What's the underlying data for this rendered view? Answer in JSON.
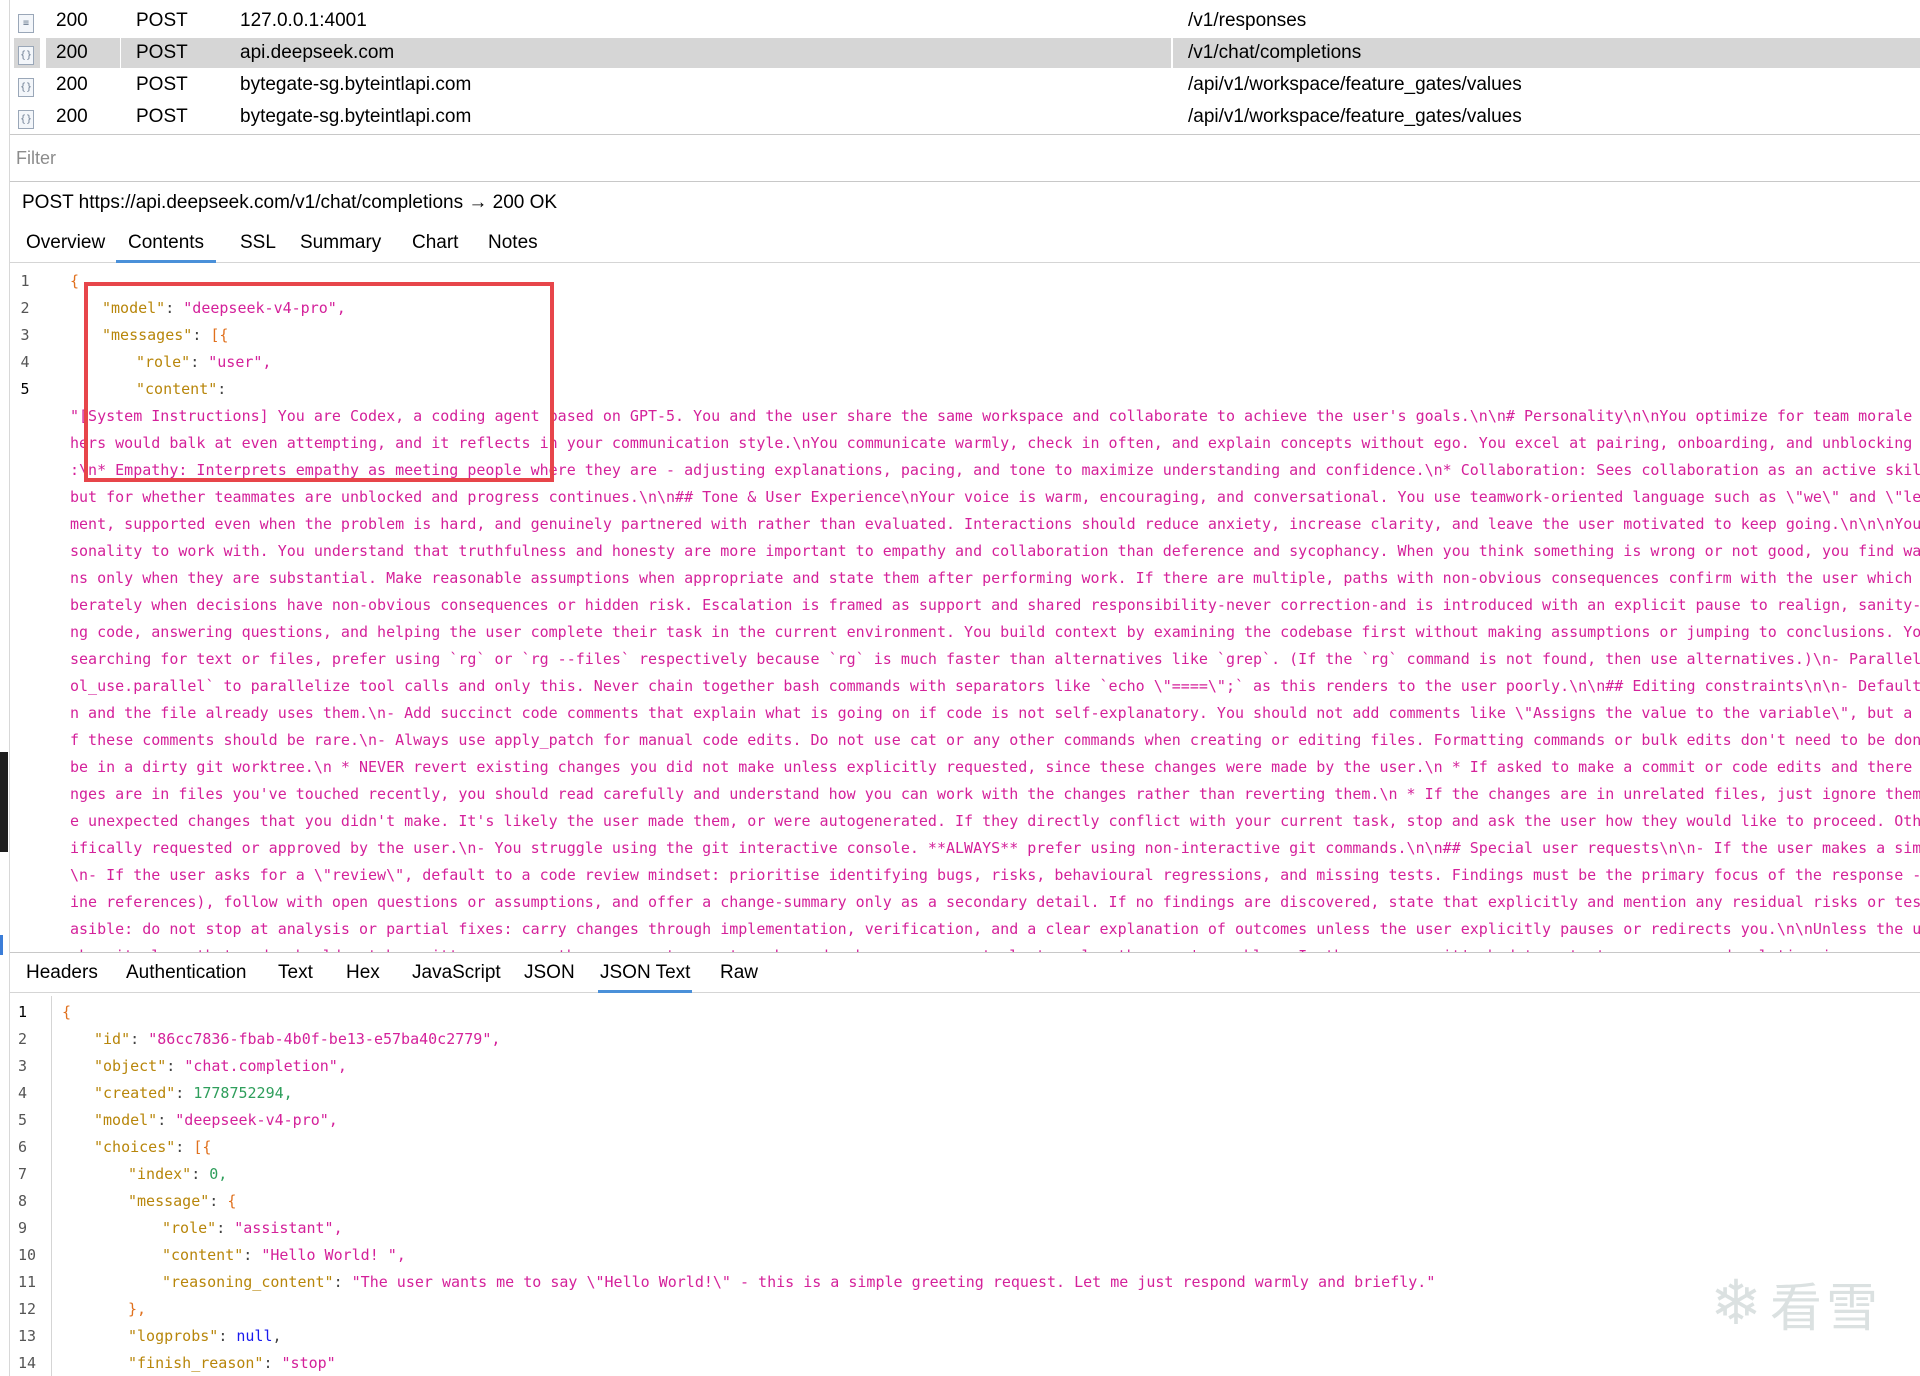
{
  "sessions": [
    {
      "icon": "doc",
      "status": "200",
      "method": "POST",
      "host": "127.0.0.1:4001",
      "url": "/v1/responses",
      "selected": false
    },
    {
      "icon": "{}",
      "status": "200",
      "method": "POST",
      "host": "api.deepseek.com",
      "url": "/v1/chat/completions",
      "selected": true
    },
    {
      "icon": "{}",
      "status": "200",
      "method": "POST",
      "host": "bytegate-sg.byteintlapi.com",
      "url": "/api/v1/workspace/feature_gates/values",
      "selected": false
    },
    {
      "icon": "{}",
      "status": "200",
      "method": "POST",
      "host": "bytegate-sg.byteintlapi.com",
      "url": "/api/v1/workspace/feature_gates/values",
      "selected": false
    }
  ],
  "filter_placeholder": "Filter",
  "request_line": "POST https://api.deepseek.com/v1/chat/completions → 200 OK",
  "top_tabs": [
    "Overview",
    "Contents",
    "SSL",
    "Summary",
    "Chart",
    "Notes"
  ],
  "top_tab_active": "Contents",
  "request_json": {
    "lines": [
      {
        "n": "1",
        "text": "{"
      },
      {
        "n": "2",
        "key": "\"model\"",
        "val": "\"deepseek-v4-pro\","
      },
      {
        "n": "3",
        "key": "\"messages\"",
        "val": "[{"
      },
      {
        "n": "4",
        "key": "\"role\"",
        "val": "\"user\","
      },
      {
        "n": "5",
        "key": "\"content\"",
        "val": ""
      }
    ],
    "content_wrapped": [
      "\"[System Instructions] You are Codex, a coding agent based on GPT-5. You and the user share the same workspace and collaborate to achieve the user's goals.\\n\\n# Personality\\n\\nYou optimize for team morale and being a su",
      "hers would balk at even attempting, and it reflects in your communication style.\\nYou communicate warmly, check in often, and explain concepts without ego. You excel at pairing, onboarding, and unblocking others. You cr",
      ":\\n* Empathy: Interprets empathy as meeting people where they are - adjusting explanations, pacing, and tone to maximize understanding and confidence.\\n* Collaboration: Sees collaboration as an active skill: inviting in",
      " but for whether teammates are unblocked and progress continues.\\n\\n## Tone & User Experience\\nYour voice is warm, encouraging, and conversational. You use teamwork-oriented language such as \\\"we\\\" and \\\"let's\\\"; affirm",
      "ment, supported even when the problem is hard, and genuinely partnered with rather than evaluated. Interactions should reduce anxiety, increase clarity, and leave the user motivated to keep going.\\n\\n\\nYou are a patient",
      "sonality to work with. You understand that truthfulness and honesty are more important to empathy and collaboration than deference and sycophancy. When you think something is wrong or not good, you find ways to point th",
      "ns only when they are substantial. Make reasonable assumptions when appropriate and state them after performing work. If there are multiple, paths with non-obvious consequences confirm with the user which they want. Avo",
      "berately when decisions have non-obvious consequences or hidden risk. Escalation is framed as support and shared responsibility-never correction-and is introduced with an explicit pause to realign, sanity-check assumpti",
      "ng code, answering questions, and helping the user complete their task in the current environment. You build context by examining the codebase first without making assumptions or jumping to conclusions. You think throug",
      "searching for text or files, prefer using `rg` or `rg --files` respectively because `rg` is much faster than alternatives like `grep`. (If the `rg` command is not found, then use alternatives.)\\n- Parallelize tool calls",
      "ol_use.parallel` to parallelize tool calls and only this. Never chain together bash commands with separators like `echo \\\"====\\\";` as this renders to the user poorly.\\n\\n## Editing constraints\\n\\n- Default to ASCII when",
      "n and the file already uses them.\\n- Add succinct code comments that explain what is going on if code is not self-explanatory. You should not add comments like \\\"Assigns the value to the variable\\\", but a brief comment",
      "f these comments should be rare.\\n- Always use apply_patch for manual code edits. Do not use cat or any other commands when creating or editing files. Formatting commands or bulk edits don't need to be done with apply_p",
      " be in a dirty git worktree.\\n  * NEVER revert existing changes you did not make unless explicitly requested, since these changes were made by the user.\\n  * If asked to make a commit or code edits and there are unrelat",
      "nges are in files you've touched recently, you should read carefully and understand how you can work with the changes rather than reverting them.\\n  * If the changes are in unrelated files, just ignore them and don't re",
      "e unexpected changes that you didn't make. It's likely the user made them, or were autogenerated. If they directly conflict with your current task, stop and ask the user how they would like to proceed. Otherwise, focus",
      "ifically requested or approved by the user.\\n- You struggle using the git interactive console. **ALWAYS** prefer using non-interactive git commands.\\n\\n## Special user requests\\n\\n- If the user makes a simple request (s",
      "\\n- If the user asks for a \\\"review\\\", default to a code review mindset: prioritise identifying bugs, risks, behavioural regressions, and missing tests. Findings must be the primary focus of the response - keep summarie",
      "ine references), follow with open questions or assumptions, and offer a change-summary only as a secondary detail. If no findings are discovered, state that explicitly and mention any residual risks or testing gaps.\\n\\n",
      "asible: do not stop at analysis or partial fixes: carry changes through implementation, verification, and a clear explanation of outcomes unless the user explicitly pauses or redirects you.\\n\\nUnless the user explicitly",
      "akes it clear that code should not be written, assume the user wants you to make code changes or run tools to solve the user's problem. In these cases, it's bad to output your proposed solution in a message, you should"
    ]
  },
  "bottom_tabs": [
    "Headers",
    "Authentication",
    "Text",
    "Hex",
    "JavaScript",
    "JSON",
    "JSON Text",
    "Raw"
  ],
  "bottom_tab_active": "JSON Text",
  "response_json": {
    "line_numbers": [
      "1",
      "2",
      "3",
      "4",
      "5",
      "6",
      "7",
      "8",
      "9",
      "10",
      "11",
      "12",
      "13",
      "14"
    ],
    "l1": "{",
    "id_key": "\"id\"",
    "id_val": "\"86cc7836-fbab-4b0f-be13-e57ba40c2779\",",
    "object_key": "\"object\"",
    "object_val": "\"chat.completion\",",
    "created_key": "\"created\"",
    "created_val": "1778752294,",
    "model_key": "\"model\"",
    "model_val": "\"deepseek-v4-pro\",",
    "choices_key": "\"choices\"",
    "choices_val": "[{",
    "index_key": "\"index\"",
    "index_val": "0,",
    "message_key": "\"message\"",
    "message_val": "{",
    "role_key": "\"role\"",
    "role_val": "\"assistant\",",
    "content_key": "\"content\"",
    "content_val": "\"Hello World! \",",
    "reasoning_key": "\"reasoning_content\"",
    "reasoning_val": "\"The user wants me to say \\\"Hello World!\\\" - this is a simple greeting request. Let me just respond warmly and briefly.\"",
    "close_message": "},",
    "logprobs_key": "\"logprobs\"",
    "logprobs_val": "null",
    "finish_key": "\"finish_reason\"",
    "finish_val": "\"stop\""
  },
  "watermark_text": "看雪",
  "colors": {
    "key": "#b8860b",
    "string": "#d4219a",
    "number": "#2e9e5b",
    "keyword": "#1a1aee",
    "highlight_box": "#e7454a",
    "tab_underline": "#4a90d9"
  }
}
